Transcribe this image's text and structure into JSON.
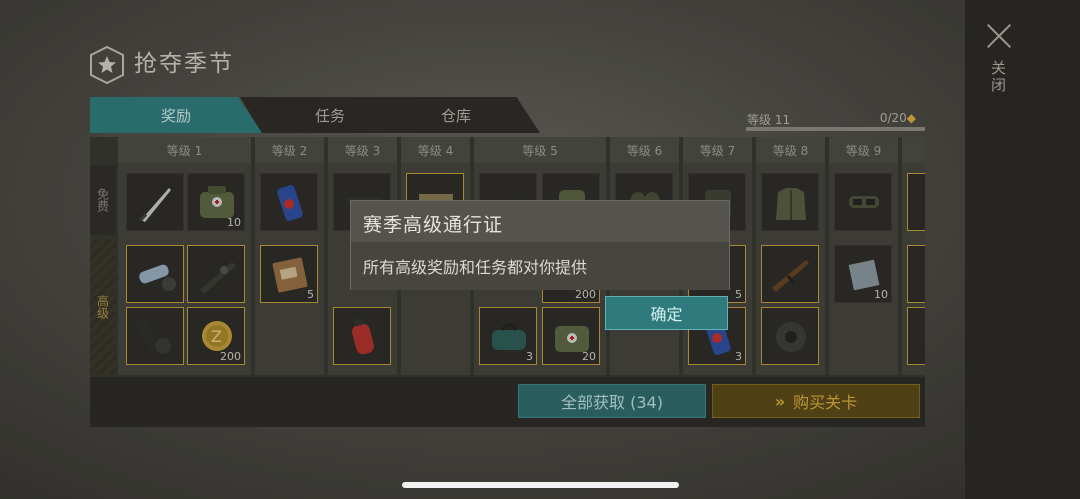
{
  "header": {
    "title": "抢夺季节",
    "close_label": "关闭"
  },
  "tabs": [
    {
      "label": "奖励",
      "active": true
    },
    {
      "label": "任务",
      "active": false
    },
    {
      "label": "仓库",
      "active": false
    }
  ],
  "level": {
    "label": "等级 11",
    "progress": "0/20",
    "diamond": "◆",
    "progress_fraction": 0.0
  },
  "rows": {
    "free": "免费",
    "premium": "高级"
  },
  "columns": [
    {
      "label": "等级 1"
    },
    {
      "label": "等级 2"
    },
    {
      "label": "等级 3"
    },
    {
      "label": "等级 4"
    },
    {
      "label": "等级 5"
    },
    {
      "label": "等级 6"
    },
    {
      "label": "等级 7"
    },
    {
      "label": "等级 8"
    },
    {
      "label": "等级 9"
    },
    {
      "label": "等"
    }
  ],
  "quantities": {
    "l1_free_bag": "10",
    "l1_coin": "200",
    "l2_food": "5",
    "l5_item": "200",
    "l5_bag": "3",
    "l5_medkit": "20",
    "l7_item": "5",
    "l7_can": "3",
    "l9_plate": "10"
  },
  "footer": {
    "claim_all": "全部获取 (34)",
    "buy_levels": "购买关卡",
    "chevron": "»"
  },
  "dialog": {
    "title": "赛季高级通行证",
    "message": "所有高级奖励和任务都对你提供",
    "ok": "确定"
  },
  "colors": {
    "accent": "#2f7f82",
    "gold": "#e0b33b"
  }
}
